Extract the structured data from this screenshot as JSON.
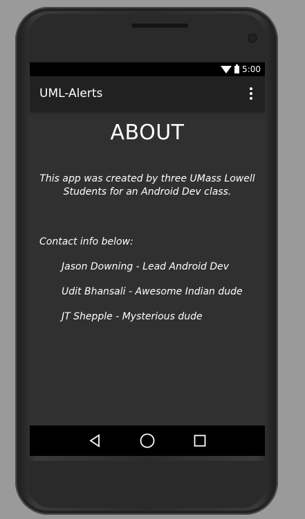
{
  "status_bar": {
    "time": "5:00"
  },
  "app_bar": {
    "title": "UML-Alerts",
    "menu_icon": "overflow-menu-icon"
  },
  "about": {
    "heading": "ABOUT",
    "intro": "This app was created by three UMass Lowell Students for an Android Dev class.",
    "contact_heading": "Contact info below:",
    "contacts": [
      "Jason Downing - Lead Android Dev",
      "Udit Bhansali - Awesome Indian dude",
      "JT Shepple - Mysterious dude"
    ]
  },
  "nav_bar": {
    "back_icon": "back-triangle-icon",
    "home_icon": "home-circle-icon",
    "recents_icon": "recents-square-icon"
  },
  "colors": {
    "background": "#9a9a9a",
    "screen": "#303030",
    "app_bar": "#212121",
    "text": "#ffffff"
  }
}
